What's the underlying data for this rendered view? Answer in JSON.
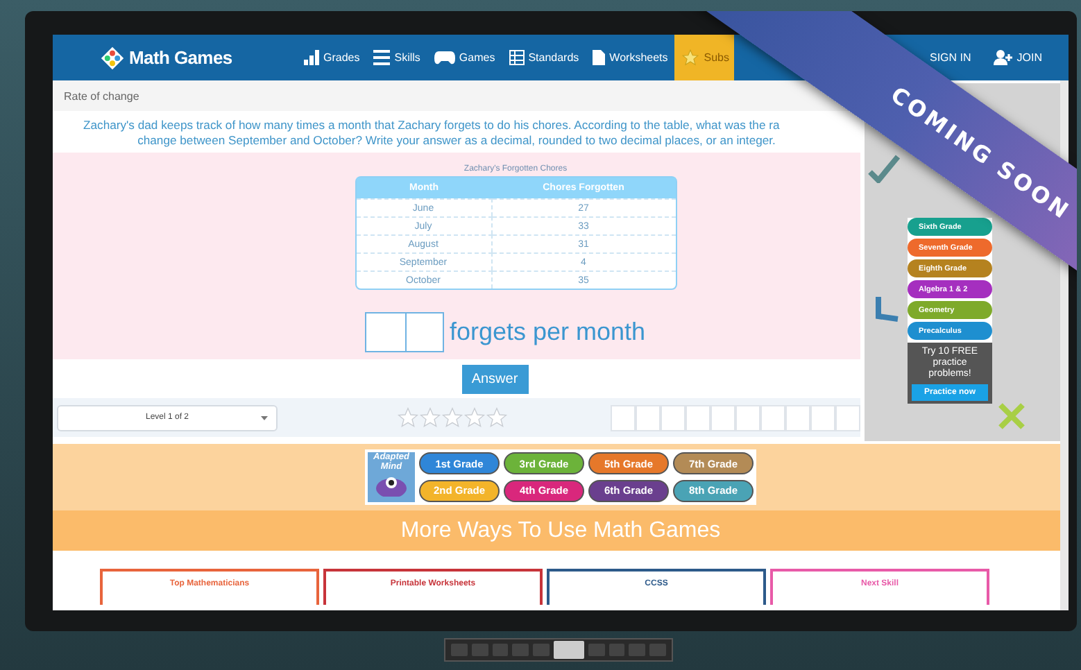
{
  "site": {
    "logo": "Math Games",
    "nav": [
      {
        "label": "Grades",
        "selected": false
      },
      {
        "label": "Skills",
        "selected": false
      },
      {
        "label": "Games",
        "selected": false
      },
      {
        "label": "Standards",
        "selected": false
      },
      {
        "label": "Worksheets",
        "selected": false
      },
      {
        "label": "Subs",
        "selected": true
      }
    ],
    "account": [
      "SIGN IN",
      "JOIN"
    ]
  },
  "breadcrumb": "Rate of change",
  "question": [
    "Zachary's dad keeps track of how many times a month that Zachary forgets to do his chores. According to the table, what was the ra",
    "change between September and October? Write your answer as a decimal, rounded to two decimal places, or an integer."
  ],
  "table": {
    "caption": "Zachary's Forgotten Chores",
    "columns": [
      "Month",
      "Chores Forgotten"
    ],
    "rows": [
      [
        "June",
        "27"
      ],
      [
        "July",
        "33"
      ],
      [
        "August",
        "31"
      ],
      [
        "September",
        "4"
      ],
      [
        "October",
        "35"
      ]
    ]
  },
  "answer": {
    "unit": "forgets per month",
    "button": "Answer"
  },
  "level_select": "Level 1 of 2",
  "stars": 0,
  "progress_cells": [
    {
      "filled": false
    },
    {
      "filled": false
    },
    {
      "filled": false
    },
    {
      "filled": false
    },
    {
      "filled": false
    },
    {
      "filled": false
    },
    {
      "filled": false
    },
    {
      "filled": false
    },
    {
      "filled": false
    },
    {
      "filled": false
    }
  ],
  "side_ad": {
    "grades": [
      {
        "label": "Sixth Grade",
        "color": "#17a08e"
      },
      {
        "label": "Seventh Grade",
        "color": "#ee6a2c"
      },
      {
        "label": "Eighth Grade",
        "color": "#b5821f"
      },
      {
        "label": "Algebra 1 & 2",
        "color": "#a52fbf"
      },
      {
        "label": "Geometry",
        "color": "#7eaa2a"
      },
      {
        "label": "Precalculus",
        "color": "#1e8fd0"
      }
    ],
    "promo": "Try 10 FREE practice problems!",
    "cta": "Practice now"
  },
  "banner_ad": {
    "brand": [
      "Adapted",
      "Mind"
    ],
    "grades": [
      {
        "label": "1st Grade",
        "color": "#2f86d8"
      },
      {
        "label": "3rd Grade",
        "color": "#6cb33a"
      },
      {
        "label": "5th Grade",
        "color": "#e6782a"
      },
      {
        "label": "7th Grade",
        "color": "#b38b56"
      },
      {
        "label": "2nd Grade",
        "color": "#f3b42a"
      },
      {
        "label": "4th Grade",
        "color": "#d9277c"
      },
      {
        "label": "6th Grade",
        "color": "#6a3f8e"
      },
      {
        "label": "8th Grade",
        "color": "#4aa3b5"
      }
    ]
  },
  "more_heading": "More Ways To Use Math Games",
  "cards": [
    {
      "label": "Top Mathematicians",
      "color": "#e8643c"
    },
    {
      "label": "Printable Worksheets",
      "color": "#c7343a"
    },
    {
      "label": "CCSS",
      "color": "#2d5a8a"
    },
    {
      "label": "Next Skill",
      "color": "#e85aa8"
    }
  ],
  "ribbon": "COMING SOON"
}
